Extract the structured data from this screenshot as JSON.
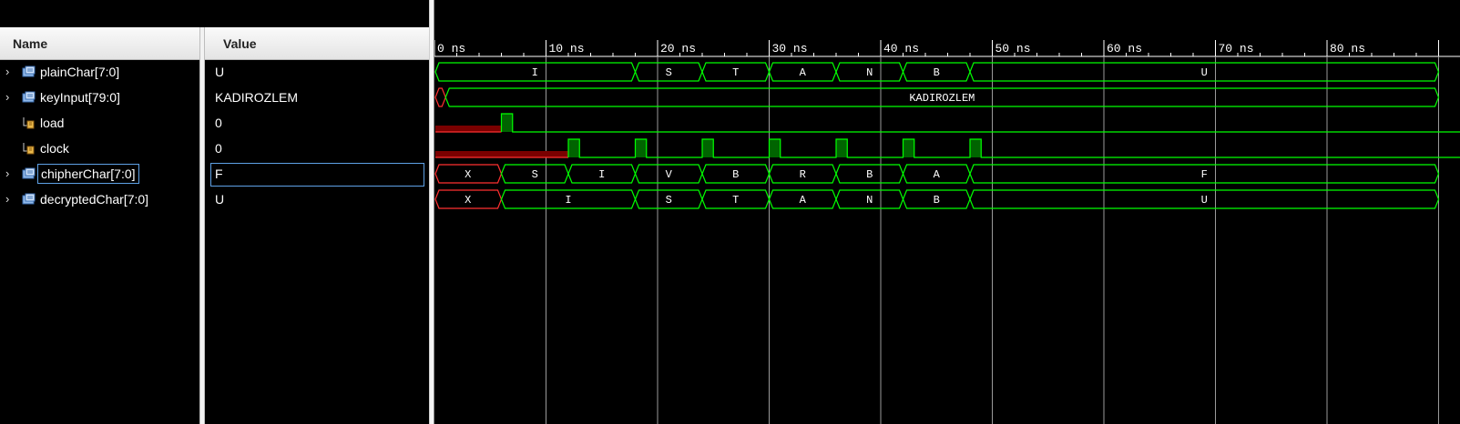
{
  "header": {
    "name_label": "Name",
    "value_label": "Value"
  },
  "signals": [
    {
      "name": "plainChar[7:0]",
      "value": "U",
      "expandable": true,
      "icon": "bus-icon"
    },
    {
      "name": "keyInput[79:0]",
      "value": "KADIROZLEM",
      "expandable": true,
      "icon": "bus-icon"
    },
    {
      "name": "load",
      "value": "0",
      "expandable": false,
      "icon": "wire-icon"
    },
    {
      "name": "clock",
      "value": "0",
      "expandable": false,
      "icon": "wire-icon"
    },
    {
      "name": "chipherChar[7:0]",
      "value": "F",
      "expandable": true,
      "icon": "bus-icon",
      "selected": true
    },
    {
      "name": "decryptedChar[7:0]",
      "value": "U",
      "expandable": true,
      "icon": "bus-icon"
    }
  ],
  "ruler_labels": [
    "0 ns",
    "10 ns",
    "20 ns",
    "30 ns",
    "40 ns",
    "50 ns",
    "60 ns",
    "70 ns",
    "80 ns"
  ],
  "colors": {
    "wave_green": "#00ff00",
    "undefined_red": "#ff3030",
    "grid": "#9a9a9a"
  },
  "waves": {
    "plainChar": [
      {
        "from": 0,
        "to": 18,
        "label": "I"
      },
      {
        "from": 18,
        "to": 24,
        "label": "S"
      },
      {
        "from": 24,
        "to": 30,
        "label": "T"
      },
      {
        "from": 30,
        "to": 36,
        "label": "A"
      },
      {
        "from": 36,
        "to": 42,
        "label": "N"
      },
      {
        "from": 42,
        "to": 48,
        "label": "B"
      },
      {
        "from": 48,
        "to": 90,
        "label": "U"
      }
    ],
    "keyInput": [
      {
        "from": 0,
        "to": 1,
        "label": "",
        "undefined": true
      },
      {
        "from": 1,
        "to": 90,
        "label": "KADIROZLEM"
      }
    ],
    "chipherChar": [
      {
        "from": 0,
        "to": 6,
        "label": "X",
        "undefined": true
      },
      {
        "from": 6,
        "to": 12,
        "label": "S"
      },
      {
        "from": 12,
        "to": 18,
        "label": "I"
      },
      {
        "from": 18,
        "to": 24,
        "label": "V"
      },
      {
        "from": 24,
        "to": 30,
        "label": "B"
      },
      {
        "from": 30,
        "to": 36,
        "label": "R"
      },
      {
        "from": 36,
        "to": 42,
        "label": "B"
      },
      {
        "from": 42,
        "to": 48,
        "label": "A"
      },
      {
        "from": 48,
        "to": 90,
        "label": "F"
      }
    ],
    "decryptedChar": [
      {
        "from": 0,
        "to": 6,
        "label": "X",
        "undefined": true
      },
      {
        "from": 6,
        "to": 18,
        "label": "I"
      },
      {
        "from": 18,
        "to": 24,
        "label": "S"
      },
      {
        "from": 24,
        "to": 30,
        "label": "T"
      },
      {
        "from": 30,
        "to": 36,
        "label": "A"
      },
      {
        "from": 36,
        "to": 42,
        "label": "N"
      },
      {
        "from": 42,
        "to": 48,
        "label": "B"
      },
      {
        "from": 48,
        "to": 90,
        "label": "U"
      }
    ],
    "load": {
      "undefined_until": 6,
      "high_from": 6,
      "high_to": 7
    },
    "clock": {
      "undefined_until": 12,
      "pulses": [
        12,
        18,
        24,
        30,
        36,
        42,
        48
      ],
      "pulse_width": 1
    }
  }
}
